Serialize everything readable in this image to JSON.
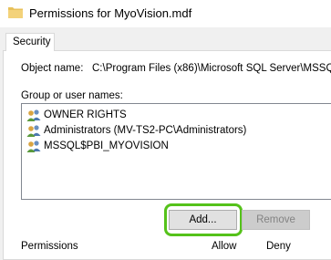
{
  "window": {
    "title": "Permissions for MyoVision.mdf"
  },
  "tabs": [
    {
      "label": "Security"
    }
  ],
  "object_name": {
    "label": "Object name:",
    "value": "C:\\Program Files (x86)\\Microsoft SQL Server\\MSSQ"
  },
  "group_list": {
    "label": "Group or user names:",
    "items": [
      {
        "label": "OWNER RIGHTS",
        "icon": "users-icon"
      },
      {
        "label": "Administrators (MV-TS2-PC\\Administrators)",
        "icon": "users-icon"
      },
      {
        "label": "MSSQL$PBI_MYOVISION",
        "icon": "users-icon"
      }
    ]
  },
  "buttons": {
    "add": "Add...",
    "remove": "Remove"
  },
  "permissions_header": {
    "label": "Permissions",
    "allow": "Allow",
    "deny": "Deny"
  },
  "colors": {
    "highlight": "#55c21a",
    "folder": "#e8c15a"
  }
}
